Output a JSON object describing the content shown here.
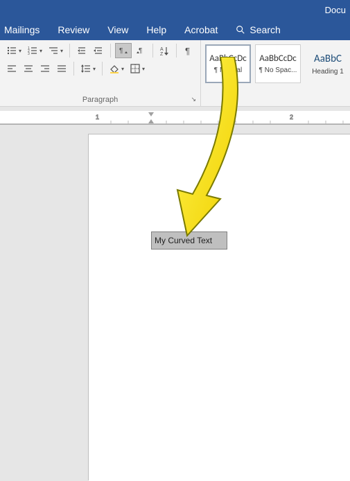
{
  "titlebar": {
    "title": "Docu"
  },
  "tabs": {
    "items": [
      "Mailings",
      "Review",
      "View",
      "Help",
      "Acrobat"
    ],
    "search_label": "Search"
  },
  "paragraph_group": {
    "label": "Paragraph"
  },
  "styles": {
    "items": [
      {
        "sample": "AaBbCcDc",
        "name": "¶ Normal",
        "selected": true
      },
      {
        "sample": "AaBbCcDc",
        "name": "¶ No Spac...",
        "selected": false
      },
      {
        "sample": "AaBbC",
        "name": "Heading 1",
        "selected": false,
        "big": true
      }
    ]
  },
  "ruler": {
    "marks": [
      "1",
      "2"
    ]
  },
  "document": {
    "textbox_content": "My Curved Text"
  },
  "chart_data": null
}
